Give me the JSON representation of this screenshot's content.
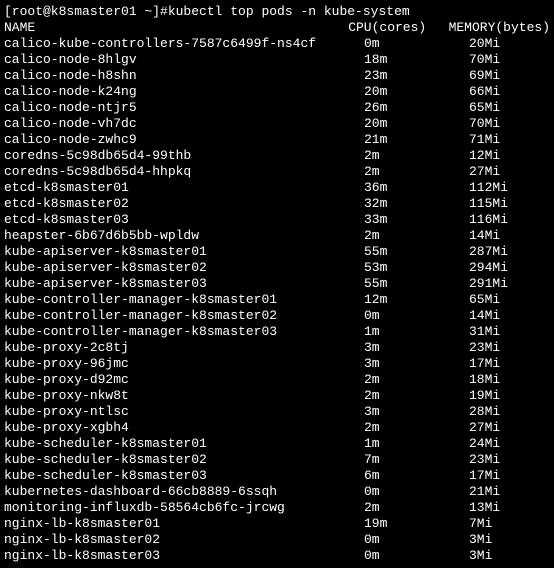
{
  "prompt": "[root@k8smaster01 ~]# ",
  "command": "kubectl top pods -n kube-system",
  "headers": {
    "name": "NAME",
    "cpu": "CPU(cores)",
    "memory": "MEMORY(bytes)"
  },
  "rows": [
    {
      "name": "calico-kube-controllers-7587c6499f-ns4cf",
      "cpu": "0m",
      "memory": "20Mi"
    },
    {
      "name": "calico-node-8hlgv",
      "cpu": "18m",
      "memory": "70Mi"
    },
    {
      "name": "calico-node-h8shn",
      "cpu": "23m",
      "memory": "69Mi"
    },
    {
      "name": "calico-node-k24ng",
      "cpu": "20m",
      "memory": "66Mi"
    },
    {
      "name": "calico-node-ntjr5",
      "cpu": "26m",
      "memory": "65Mi"
    },
    {
      "name": "calico-node-vh7dc",
      "cpu": "20m",
      "memory": "70Mi"
    },
    {
      "name": "calico-node-zwhc9",
      "cpu": "21m",
      "memory": "71Mi"
    },
    {
      "name": "coredns-5c98db65d4-99thb",
      "cpu": "2m",
      "memory": "12Mi"
    },
    {
      "name": "coredns-5c98db65d4-hhpkq",
      "cpu": "2m",
      "memory": "27Mi"
    },
    {
      "name": "etcd-k8smaster01",
      "cpu": "36m",
      "memory": "112Mi"
    },
    {
      "name": "etcd-k8smaster02",
      "cpu": "32m",
      "memory": "115Mi"
    },
    {
      "name": "etcd-k8smaster03",
      "cpu": "33m",
      "memory": "116Mi"
    },
    {
      "name": "heapster-6b67d6b5bb-wpldw",
      "cpu": "2m",
      "memory": "14Mi"
    },
    {
      "name": "kube-apiserver-k8smaster01",
      "cpu": "55m",
      "memory": "287Mi"
    },
    {
      "name": "kube-apiserver-k8smaster02",
      "cpu": "53m",
      "memory": "294Mi"
    },
    {
      "name": "kube-apiserver-k8smaster03",
      "cpu": "55m",
      "memory": "291Mi"
    },
    {
      "name": "kube-controller-manager-k8smaster01",
      "cpu": "12m",
      "memory": "65Mi"
    },
    {
      "name": "kube-controller-manager-k8smaster02",
      "cpu": "0m",
      "memory": "14Mi"
    },
    {
      "name": "kube-controller-manager-k8smaster03",
      "cpu": "1m",
      "memory": "31Mi"
    },
    {
      "name": "kube-proxy-2c8tj",
      "cpu": "3m",
      "memory": "23Mi"
    },
    {
      "name": "kube-proxy-96jmc",
      "cpu": "3m",
      "memory": "17Mi"
    },
    {
      "name": "kube-proxy-d92mc",
      "cpu": "2m",
      "memory": "18Mi"
    },
    {
      "name": "kube-proxy-nkw8t",
      "cpu": "2m",
      "memory": "19Mi"
    },
    {
      "name": "kube-proxy-ntlsc",
      "cpu": "3m",
      "memory": "28Mi"
    },
    {
      "name": "kube-proxy-xgbh4",
      "cpu": "2m",
      "memory": "27Mi"
    },
    {
      "name": "kube-scheduler-k8smaster01",
      "cpu": "1m",
      "memory": "24Mi"
    },
    {
      "name": "kube-scheduler-k8smaster02",
      "cpu": "7m",
      "memory": "23Mi"
    },
    {
      "name": "kube-scheduler-k8smaster03",
      "cpu": "6m",
      "memory": "17Mi"
    },
    {
      "name": "kubernetes-dashboard-66cb8889-6ssqh",
      "cpu": "0m",
      "memory": "21Mi"
    },
    {
      "name": "monitoring-influxdb-58564cb6fc-jrcwg",
      "cpu": "2m",
      "memory": "13Mi"
    },
    {
      "name": "nginx-lb-k8smaster01",
      "cpu": "19m",
      "memory": "7Mi"
    },
    {
      "name": "nginx-lb-k8smaster02",
      "cpu": "0m",
      "memory": "3Mi"
    },
    {
      "name": "nginx-lb-k8smaster03",
      "cpu": "0m",
      "memory": "3Mi"
    }
  ]
}
